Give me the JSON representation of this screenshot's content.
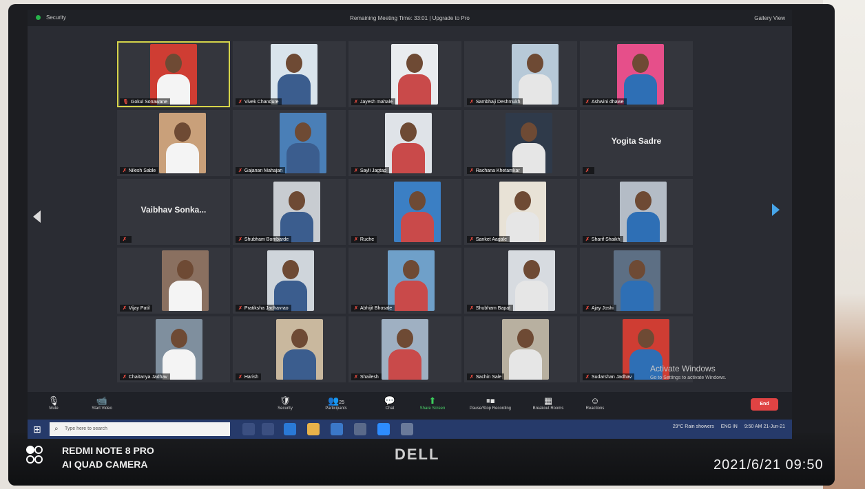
{
  "window": {
    "left_label": "Security",
    "title": "Remaining Meeting Time: 33:01 | Upgrade to Pro",
    "right_label": "Gallery View"
  },
  "participants": [
    {
      "name": "Gokul Sonawane",
      "type": "photo",
      "active": true,
      "muted": false
    },
    {
      "name": "Vivek Chandure",
      "type": "photo",
      "muted": true
    },
    {
      "name": "Jayesh mahale",
      "type": "photo",
      "muted": true
    },
    {
      "name": "Sambhaji Deshmukh",
      "type": "photo",
      "muted": true
    },
    {
      "name": "Ashwini dhawe",
      "type": "photo",
      "muted": true
    },
    {
      "name": "Nilesh Sable",
      "type": "photo",
      "muted": true
    },
    {
      "name": "Gajanan Mahajan",
      "type": "photo",
      "muted": true
    },
    {
      "name": "Sayli Jagtap",
      "type": "photo",
      "muted": true
    },
    {
      "name": "Rachana Khetamkar",
      "type": "photo",
      "muted": true
    },
    {
      "name": "Yogita Sadre",
      "type": "text",
      "muted": true
    },
    {
      "name": "Vaibhav Sonka...",
      "type": "text",
      "muted": true
    },
    {
      "name": "Shubham Bombarde",
      "type": "photo",
      "muted": true
    },
    {
      "name": "Ruche",
      "type": "photo",
      "muted": true
    },
    {
      "name": "Sanket Aagale",
      "type": "photo",
      "muted": true
    },
    {
      "name": "Sharif Shaikh",
      "type": "photo",
      "muted": true
    },
    {
      "name": "Vijay Patil",
      "type": "photo",
      "muted": true
    },
    {
      "name": "Pratiksha Jadhavrao",
      "type": "photo",
      "muted": true
    },
    {
      "name": "Abhijit Bhosale",
      "type": "photo",
      "muted": true
    },
    {
      "name": "Shubham Bapat",
      "type": "photo",
      "muted": true
    },
    {
      "name": "Ajay Joshi",
      "type": "photo",
      "muted": true
    },
    {
      "name": "Chaitanya Jadhav",
      "type": "photo",
      "muted": true
    },
    {
      "name": "Harish",
      "type": "photo",
      "muted": true
    },
    {
      "name": "Shailesh",
      "type": "photo",
      "muted": true
    },
    {
      "name": "Sachin Sale",
      "type": "photo",
      "muted": true
    },
    {
      "name": "Sudarshan Jadhav",
      "type": "photo",
      "muted": true
    }
  ],
  "toolbar": {
    "mute": "Mute",
    "start_video": "Start Video",
    "security": "Security",
    "participants": "Participants",
    "participants_count": "25",
    "chat": "Chat",
    "share_screen": "Share Screen",
    "recording": "Pause/Stop Recording",
    "breakout": "Breakout Rooms",
    "reactions": "Reactions",
    "end": "End"
  },
  "activation": {
    "title": "Activate Windows",
    "subtitle": "Go to Settings to activate Windows."
  },
  "taskbar": {
    "search_placeholder": "Type here to search",
    "weather": "29°C Rain showers",
    "lang": "ENG IN",
    "time": "9:50 AM",
    "date": "21-Jun-21"
  },
  "device": {
    "brand": "DELL",
    "camera_line1": "REDMI NOTE 8 PRO",
    "camera_line2": "AI QUAD CAMERA",
    "timestamp": "2021/6/21 09:50"
  },
  "colors": {
    "accent_active": "#d6d54a",
    "muted_icon": "#e34a3f",
    "end_button": "#e04343",
    "share_screen": "#27b34a",
    "taskbar": "#263a6a"
  },
  "icons": {
    "mic": "microphone-icon",
    "video": "video-camera-icon",
    "security": "shield-icon",
    "participants": "people-icon",
    "chat": "chat-bubble-icon",
    "share": "share-screen-icon",
    "record": "pause-stop-icon",
    "breakout": "grid-icon",
    "reactions": "smile-icon"
  }
}
